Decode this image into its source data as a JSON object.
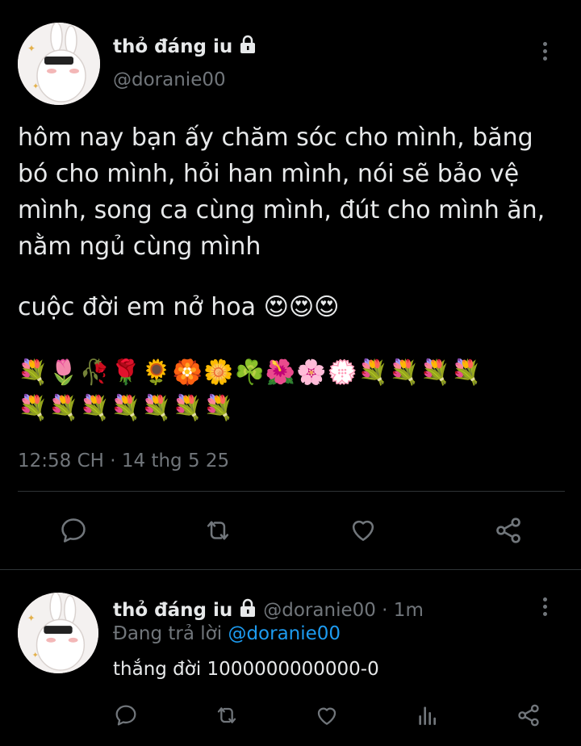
{
  "main_tweet": {
    "author_name": "thỏ đáng iu",
    "handle": "@doranie00",
    "text_lines": [
      "hôm nay bạn ấy chăm sóc cho mình, băng",
      "bó cho mình, hỏi han mình, nói sẽ bảo vệ",
      "mình, song ca cùng mình, đút cho mình ăn,",
      "nằm ngủ cùng mình"
    ],
    "line2": "cuộc đời em nở hoa 😍😍😍",
    "emoji_row1": "💐🌷🥀🌹🌻🏵️🌼☘️🌺🌸💮💐💐💐💐",
    "emoji_row2": "💐💐💐💐💐💐💐",
    "timestamp": "12:58 CH · 14 thg 5 25",
    "icons": [
      "reply-icon",
      "retweet-icon",
      "like-icon",
      "share-icon"
    ]
  },
  "reply_tweet": {
    "author_name": "thỏ đáng iu",
    "handle_time": "@doranie00 · 1m",
    "replying_prefix": "Đang trả lời ",
    "replying_to": "@doranie00",
    "text": "thắng đời 1000000000000-0",
    "icons": [
      "reply-icon",
      "retweet-icon",
      "like-icon",
      "analytics-icon",
      "share-icon"
    ]
  },
  "colors": {
    "background": "#000000",
    "text": "#e7e9ea",
    "muted": "#71767b",
    "accent": "#1d9bf0",
    "divider": "#2f3336"
  }
}
